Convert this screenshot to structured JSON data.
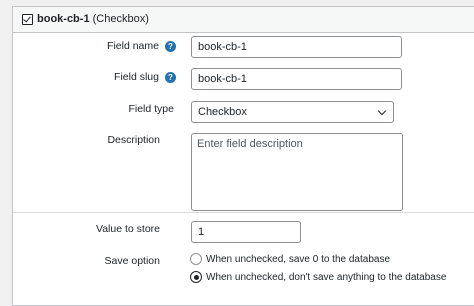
{
  "header": {
    "field_name": "book-cb-1",
    "field_type_suffix": "(Checkbox)"
  },
  "fields": {
    "name": {
      "label": "Field name",
      "value": "book-cb-1"
    },
    "slug": {
      "label": "Field slug",
      "value": "book-cb-1"
    },
    "type": {
      "label": "Field type",
      "value": "Checkbox"
    },
    "description": {
      "label": "Description",
      "placeholder": "Enter field description"
    },
    "value_to_store": {
      "label": "Value to store",
      "value": "1"
    },
    "save_option": {
      "label": "Save option",
      "options": [
        {
          "label": "When unchecked, save 0 to the database",
          "checked": false
        },
        {
          "label": "When unchecked, don't save anything to the database",
          "checked": true
        }
      ]
    }
  },
  "colors": {
    "accent": "#2271b1",
    "border": "#8c8f94"
  },
  "icons": {
    "help": "question-mark-icon",
    "header_check": "checkbox-checked-icon"
  }
}
